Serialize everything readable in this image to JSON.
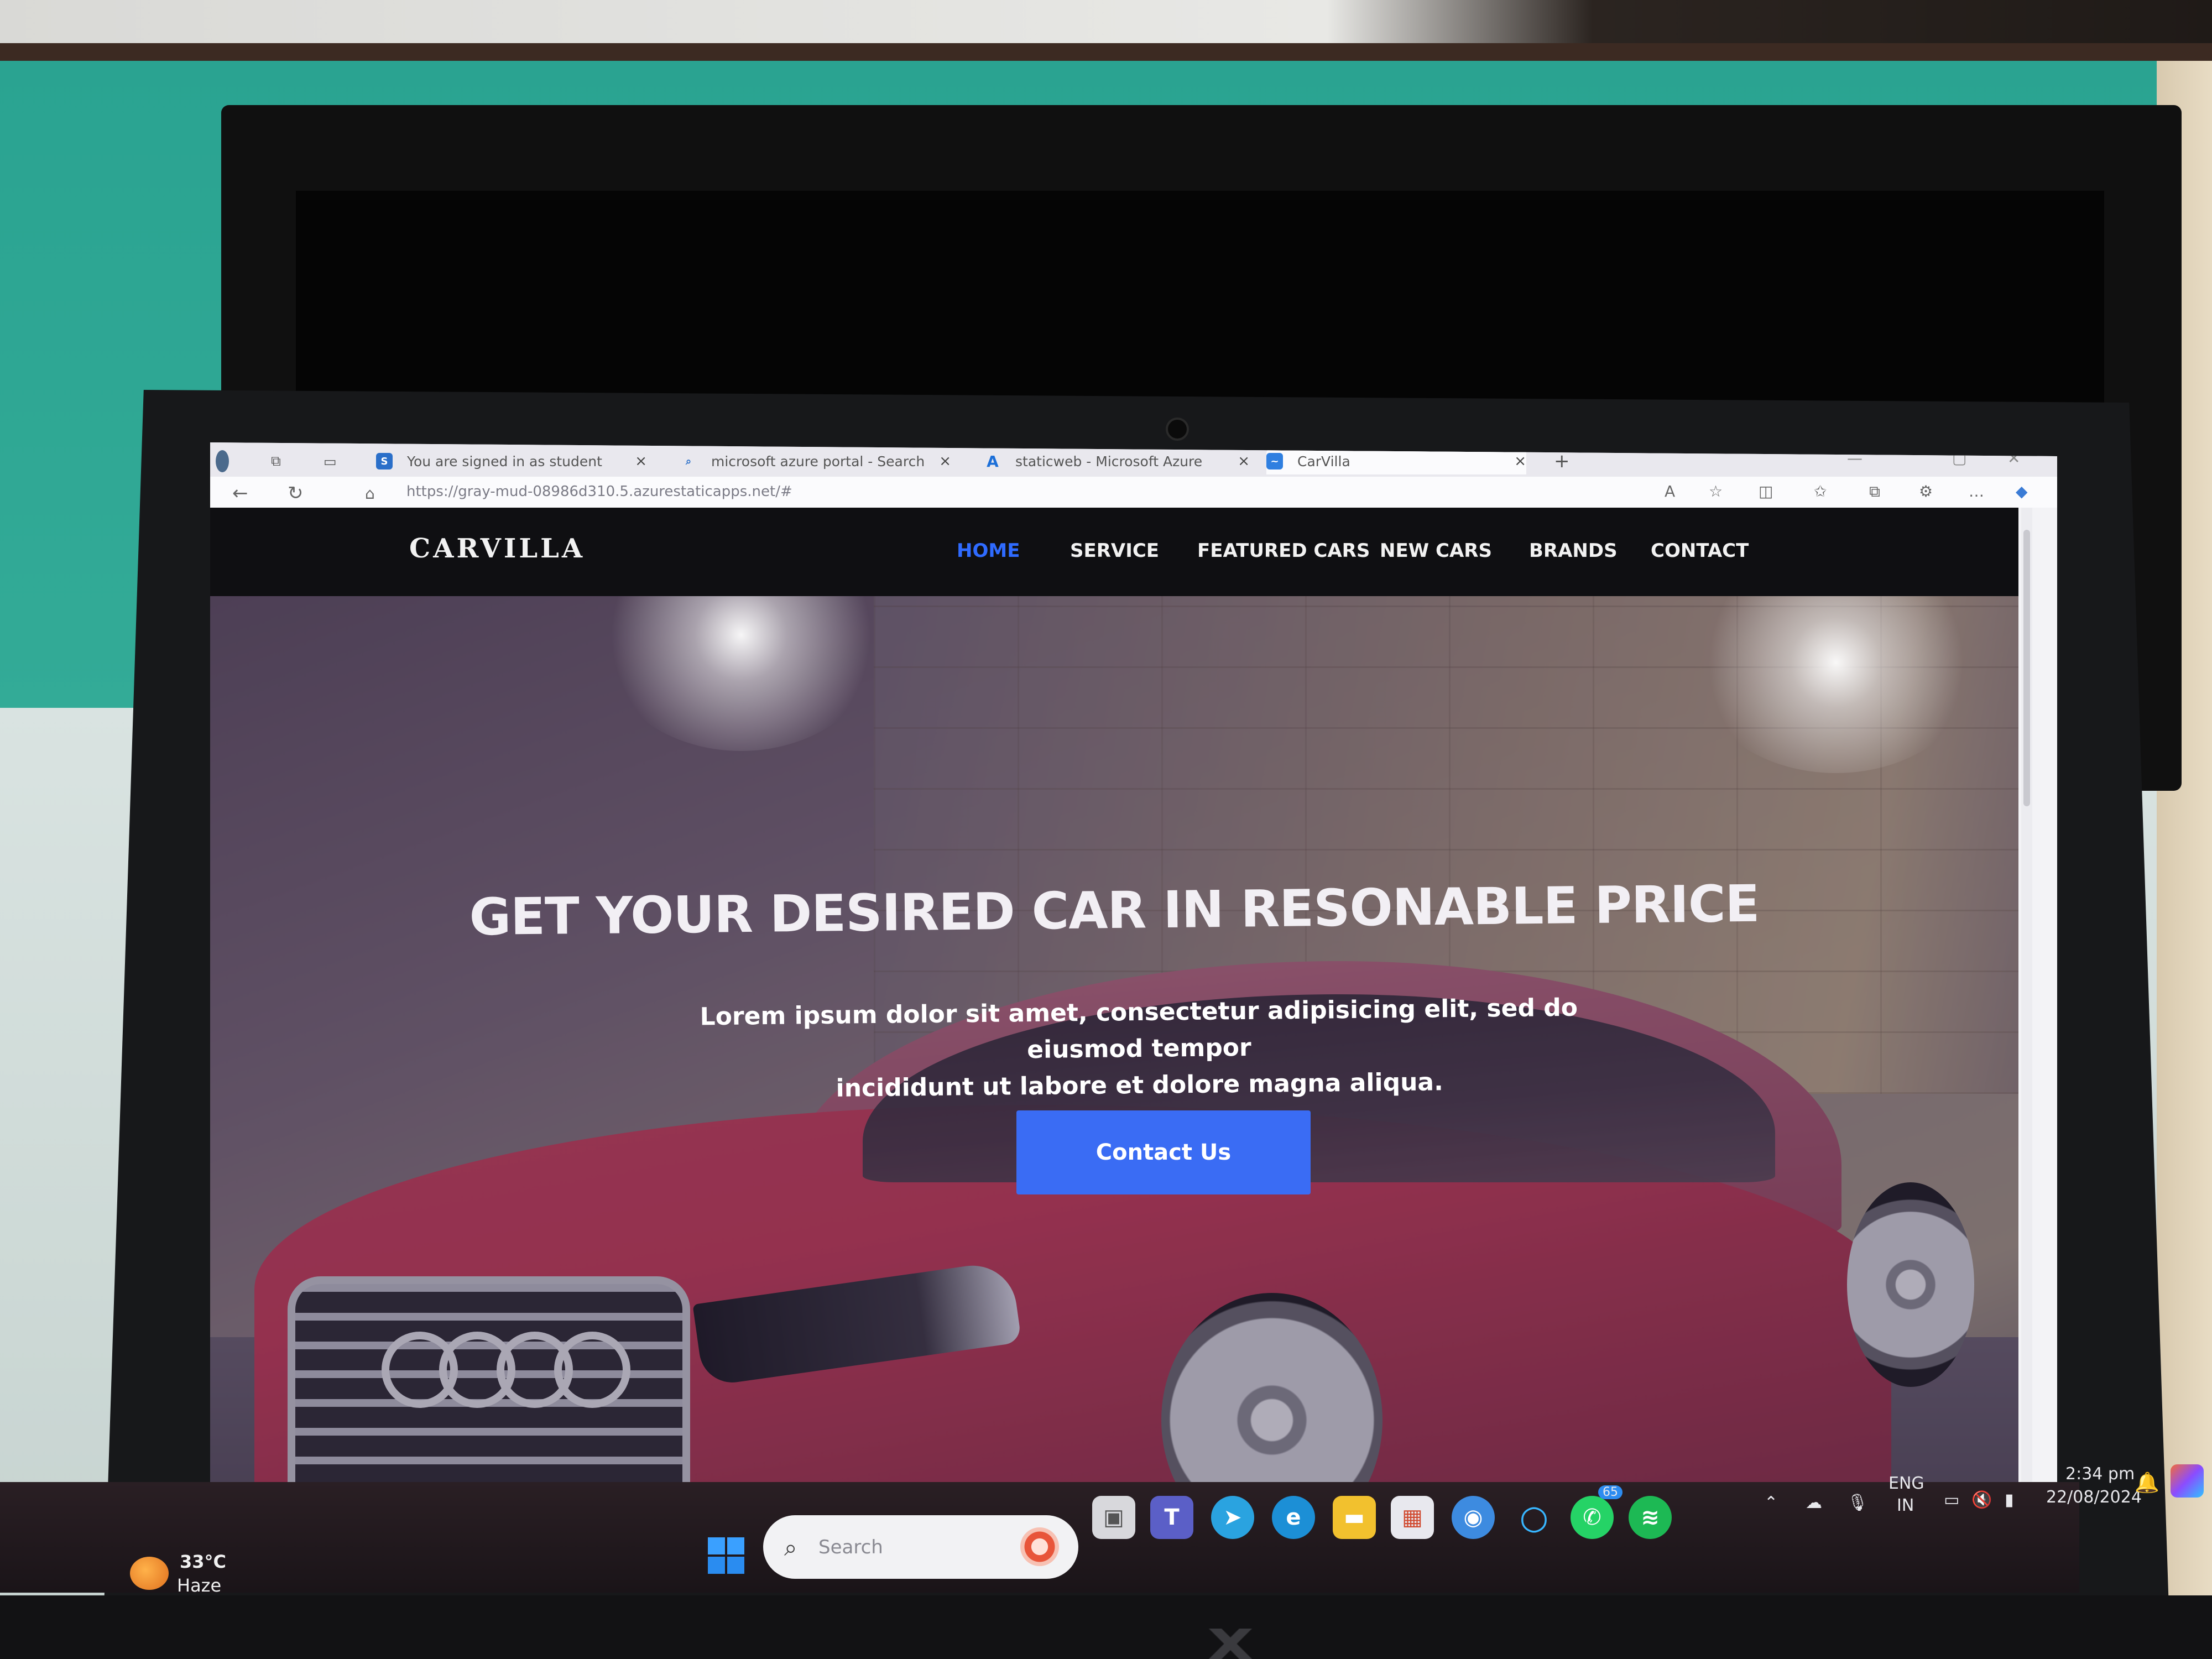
{
  "browser": {
    "tabs": [
      {
        "label": "You are signed in as student",
        "favicon": "S"
      },
      {
        "label": "microsoft azure portal - Search",
        "favicon": "search"
      },
      {
        "label": "staticweb - Microsoft Azure",
        "favicon": "A"
      },
      {
        "label": "CarVilla",
        "favicon": "carvilla"
      }
    ],
    "new_tab": "+",
    "url": "https://gray-mud-08986d310.5.azurestaticapps.net/#"
  },
  "site": {
    "logo": "CARVILLA",
    "menu": [
      "HOME",
      "SERVICE",
      "FEATURED CARS",
      "NEW CARS",
      "BRANDS",
      "CONTACT"
    ],
    "active_menu": "HOME",
    "hero_title": "GET YOUR DESIRED CAR IN RESONABLE PRICE",
    "hero_text_line1": "Lorem ipsum dolor sit amet, consectetur adipisicing elit, sed do eiusmod tempor",
    "hero_text_line2": "incididunt ut labore et dolore magna aliqua.",
    "cta_label": "Contact Us",
    "accent_color": "#3a6cf4"
  },
  "taskbar": {
    "weather_temp": "33°C",
    "weather_condition": "Haze",
    "search_placeholder": "Search",
    "language_line1": "ENG",
    "language_line2": "IN",
    "time": "2:34 pm",
    "date": "22/08/2024",
    "whatsapp_badge": "65"
  }
}
